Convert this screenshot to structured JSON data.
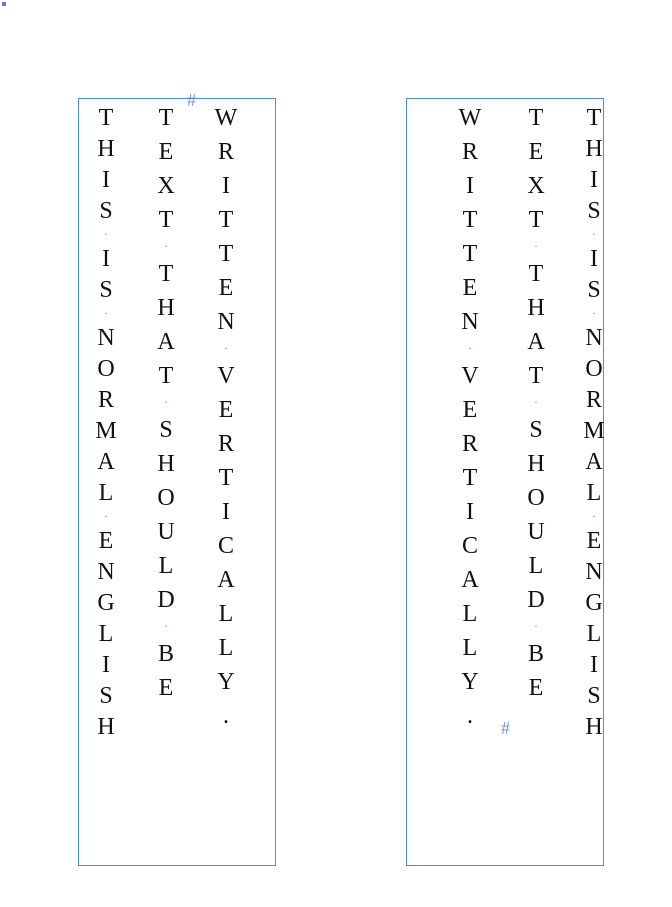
{
  "markers": {
    "hash": "#"
  },
  "frames": {
    "left": {
      "columns": [
        {
          "id": "l1",
          "text": "THIS IS NORMAL ENGLISH"
        },
        {
          "id": "l2",
          "text": "TEXT THAT SHOULD BE"
        },
        {
          "id": "l3",
          "text": "WRITTEN VERTICALLY."
        }
      ]
    },
    "right": {
      "columns": [
        {
          "id": "r1",
          "text": "WRITTEN VERTICALLY."
        },
        {
          "id": "r2",
          "text": "TEXT THAT SHOULD BE"
        },
        {
          "id": "r3",
          "text": "THIS IS NORMAL ENGLISH"
        }
      ]
    }
  }
}
